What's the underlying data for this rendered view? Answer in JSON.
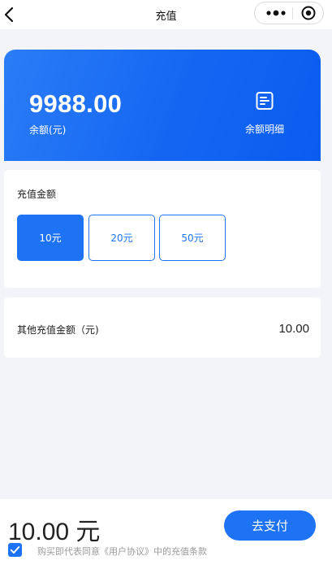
{
  "nav": {
    "title": "充值",
    "icons": {
      "back": "chevron-left-icon",
      "more": "more-dots-icon",
      "close": "target-circle-icon"
    }
  },
  "balance": {
    "amount": "9988.00",
    "label": "余额(元)",
    "detail_label": "余额明细",
    "detail_icon": "document-list-icon"
  },
  "recharge": {
    "title": "充值金额",
    "options": [
      {
        "label": "10元",
        "selected": true
      },
      {
        "label": "20元",
        "selected": false
      },
      {
        "label": "50元",
        "selected": false
      }
    ]
  },
  "other": {
    "label": "其他充值金额（元)",
    "value": "10.00"
  },
  "footer": {
    "total": "10.00 元",
    "pay_label": "去支付",
    "agreement_checked": true,
    "agreement_text": "购买即代表同意《用户协议》中的充值条款"
  },
  "colors": {
    "accent": "#1e73f5",
    "card_gradient_start": "#2b7cf6",
    "card_gradient_end": "#0a5cf0",
    "page_bg": "#f2f4f7"
  }
}
